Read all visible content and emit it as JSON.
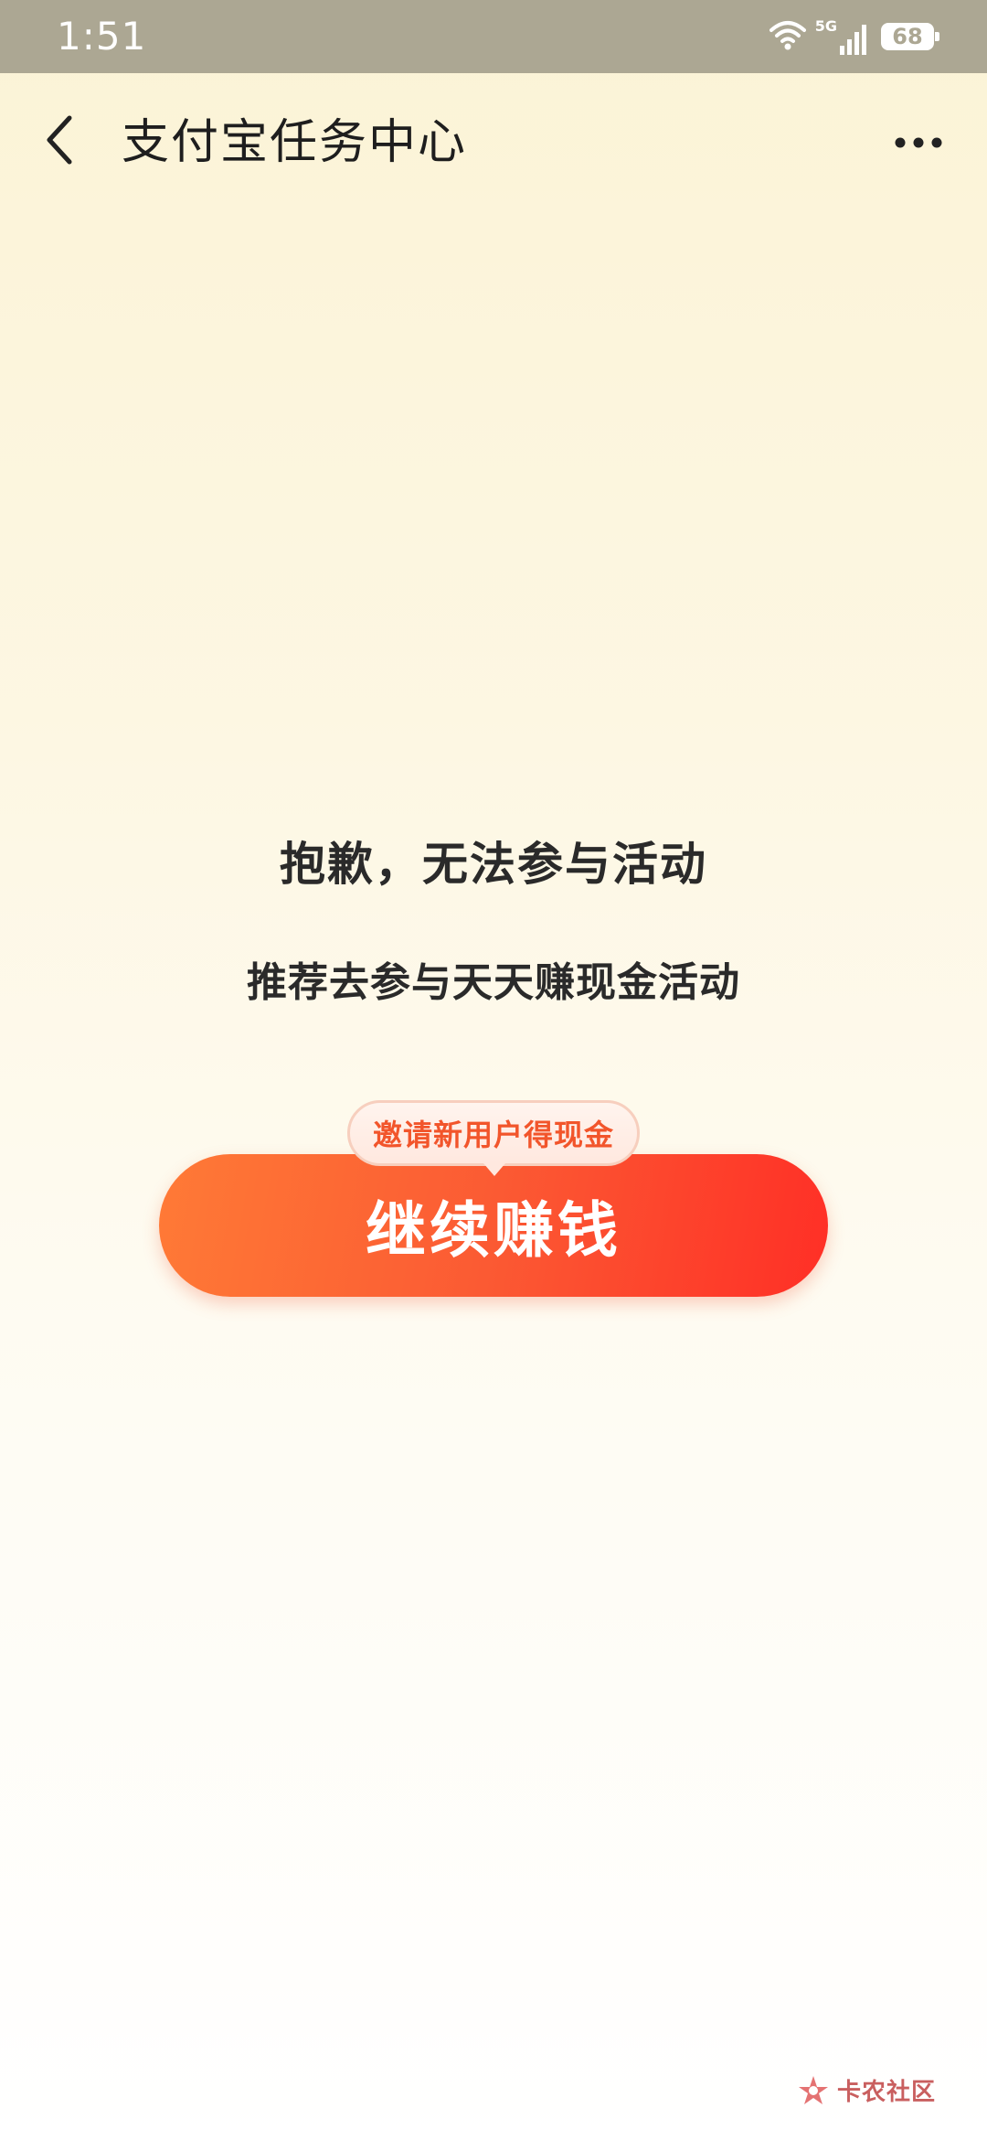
{
  "status_bar": {
    "time": "1:51",
    "network": "5G",
    "battery": "68",
    "icons": [
      "wifi-icon",
      "signal-icon",
      "battery-icon"
    ]
  },
  "header": {
    "title": "支付宝任务中心",
    "back_icon": "chevron-left-icon",
    "more_icon": "more-dots-icon"
  },
  "main": {
    "message_title": "抱歉，无法参与活动",
    "message_subtitle": "推荐去参与天天赚现金活动",
    "cta": {
      "label": "继续赚钱",
      "bubble": "邀请新用户得现金"
    }
  },
  "watermark": {
    "text": "卡农社区",
    "icon": "kanong-logo-icon"
  },
  "colors": {
    "status_bar": "#aca793",
    "cta_start": "#ff7a36",
    "cta_end": "#ff2f26",
    "bubble_text": "#f2552b"
  }
}
